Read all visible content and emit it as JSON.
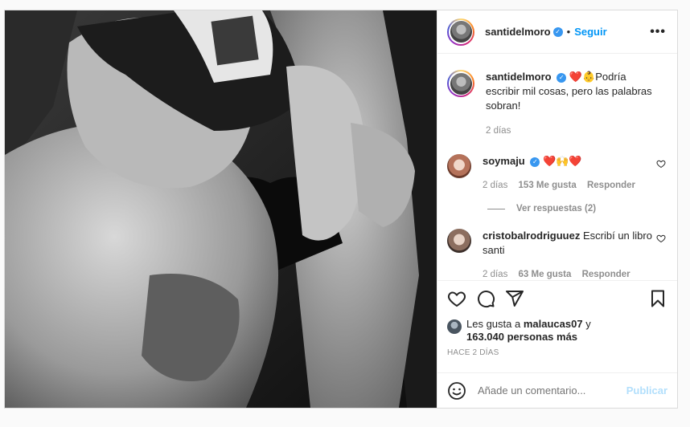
{
  "post": {
    "author": "santidelmoro",
    "follow_label": "Seguir",
    "more_label": "•••",
    "separator": "•"
  },
  "caption": {
    "username": "santidelmoro",
    "emoji": "❤️👶",
    "text": "Podría escribir mil cosas, pero las palabras sobran!",
    "time": "2 días"
  },
  "comments": [
    {
      "username": "soymaju",
      "text": "❤️🙌❤️",
      "time": "2 días",
      "likes": "153 Me gusta",
      "reply_label": "Responder",
      "view_replies": "Ver respuestas (2)"
    },
    {
      "username": "cristobalrodriguuez",
      "text": "Escribí un libro santi",
      "time": "2 días",
      "likes": "63 Me gusta",
      "reply_label": "Responder"
    }
  ],
  "likes": {
    "prefix": "Les gusta a",
    "user": "malaucas07",
    "connector": "y",
    "others": "163.040 personas más"
  },
  "timestamp": "HACE 2 DÍAS",
  "comment_box": {
    "placeholder": "Añade un comentario...",
    "publish_label": "Publicar"
  },
  "icons": {
    "like": "heart-icon",
    "comment": "comment-icon",
    "share": "share-icon",
    "save": "bookmark-icon",
    "emoji": "emoji-icon",
    "more": "more-icon",
    "verified": "verified-badge-icon"
  },
  "colors": {
    "accent": "#0095f6",
    "publish_disabled": "#b2dffc",
    "verified": "#3897f0",
    "heart_red": "#ed4956"
  }
}
